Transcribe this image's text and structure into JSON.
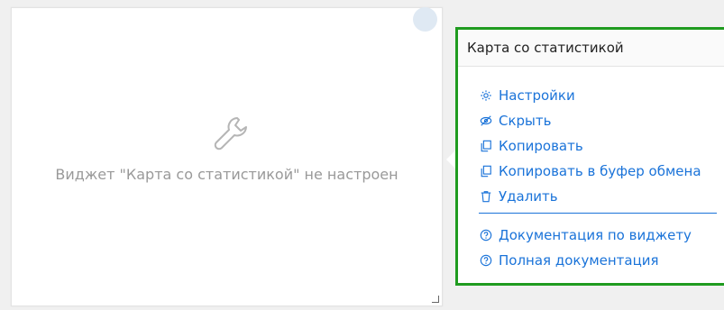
{
  "widget": {
    "message": "Виджет \"Карта со статистикой\" не настроен"
  },
  "menu": {
    "title": "Карта со статистикой",
    "items": [
      {
        "label": "Настройки",
        "icon": "gear-icon"
      },
      {
        "label": "Скрыть",
        "icon": "eye-off-icon"
      },
      {
        "label": "Копировать",
        "icon": "copy-icon"
      },
      {
        "label": "Копировать в буфер обмена",
        "icon": "clipboard-copy-icon"
      },
      {
        "label": "Удалить",
        "icon": "trash-icon"
      }
    ],
    "docs": [
      {
        "label": "Документация по виджету",
        "icon": "help-icon"
      },
      {
        "label": "Полная документация",
        "icon": "help-icon"
      }
    ]
  },
  "colors": {
    "link": "#1a73d9",
    "highlight_border": "#1f9b1f",
    "muted_text": "#999999"
  }
}
